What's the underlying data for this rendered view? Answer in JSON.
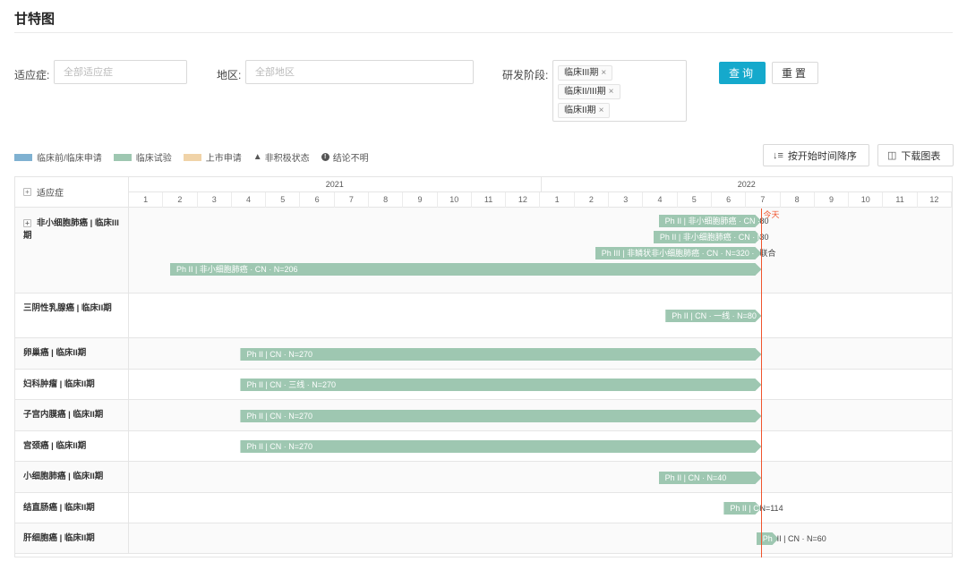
{
  "page": {
    "title": "甘特图"
  },
  "filters": {
    "indication_label": "适应症:",
    "indication_placeholder": "全部适应症",
    "region_label": "地区:",
    "region_placeholder": "全部地区",
    "phase_label": "研发阶段:",
    "phase_tags": [
      "临床III期",
      "临床II/III期",
      "临床II期"
    ],
    "tag_close": "×",
    "query_button": "查询",
    "reset_button": "重置"
  },
  "legend": {
    "items": [
      {
        "label": "临床前/临床申请",
        "color": "#7fb1d1"
      },
      {
        "label": "临床试验",
        "color": "#9ec7b1"
      },
      {
        "label": "上市申请",
        "color": "#f0d3a8"
      }
    ],
    "inactive_label": "非积极状态",
    "unknown_label": "结论不明"
  },
  "toolbar": {
    "sort_label": "按开始时间降序",
    "sort_icon": "sort-desc-icon",
    "download_label": "下载图表",
    "download_icon": "download-chart-icon"
  },
  "gantt": {
    "indication_header": "适应症",
    "years": [
      "2021",
      "2022"
    ],
    "months": [
      "1",
      "2",
      "3",
      "4",
      "5",
      "6",
      "7",
      "8",
      "9",
      "10",
      "11",
      "12",
      "1",
      "2",
      "3",
      "4",
      "5",
      "6",
      "7",
      "8",
      "9",
      "10",
      "11",
      "12"
    ],
    "today_label": "今天",
    "today_month": 18.45,
    "bar_color": "#9ec7b1",
    "rows": [
      {
        "label": "非小细胞肺癌 | 临床III期",
        "expandable": true,
        "bars": [
          {
            "start": 15.45,
            "end": 18.45,
            "text": "Ph II | 非小细胞肺癌 · CN · N=",
            "overflow": "80"
          },
          {
            "start": 15.3,
            "end": 18.45,
            "text": "Ph II | 非小细胞肺癌 · CN · N=",
            "overflow": "30"
          },
          {
            "start": 13.6,
            "end": 18.45,
            "text": "Ph III | 非鳞状非小细胞肺癌 · CN · N=320 · ",
            "overflow": "联合"
          },
          {
            "start": 1.2,
            "end": 18.45,
            "text": "Ph II | 非小细胞肺癌 · CN · N=206",
            "overflow": ""
          }
        ]
      },
      {
        "label": "三阴性乳腺癌 | 临床II期",
        "expandable": false,
        "bars": [
          {
            "start": 15.65,
            "end": 18.45,
            "text": "Ph II | CN · 一线 · N=80",
            "overflow": ""
          }
        ]
      },
      {
        "label": "卵巢癌 | 临床II期",
        "expandable": false,
        "bars": [
          {
            "start": 3.25,
            "end": 18.45,
            "text": "Ph II | CN · N=270",
            "overflow": ""
          }
        ]
      },
      {
        "label": "妇科肿瘤 | 临床II期",
        "expandable": false,
        "bars": [
          {
            "start": 3.25,
            "end": 18.45,
            "text": "Ph II | CN · 三线 · N=270",
            "overflow": ""
          }
        ]
      },
      {
        "label": "子宫内膜癌 | 临床II期",
        "expandable": false,
        "bars": [
          {
            "start": 3.25,
            "end": 18.45,
            "text": "Ph II | CN · N=270",
            "overflow": ""
          }
        ]
      },
      {
        "label": "宫颈癌 | 临床II期",
        "expandable": false,
        "bars": [
          {
            "start": 3.25,
            "end": 18.45,
            "text": "Ph II | CN · N=270",
            "overflow": ""
          }
        ]
      },
      {
        "label": "小细胞肺癌 | 临床II期",
        "expandable": false,
        "bars": [
          {
            "start": 15.45,
            "end": 18.45,
            "text": "Ph II | CN · N=40",
            "overflow": ""
          }
        ]
      },
      {
        "label": "结直肠癌 | 临床II期",
        "expandable": false,
        "bars": [
          {
            "start": 17.35,
            "end": 18.45,
            "text": "Ph II | CN",
            "overflow": "N=114"
          }
        ]
      },
      {
        "label": "肝细胞癌 | 临床II期",
        "expandable": false,
        "bars": [
          {
            "start": 18.3,
            "end": 18.95,
            "text": "Ph",
            "overflow": "II | CN · N=60"
          }
        ]
      }
    ]
  }
}
